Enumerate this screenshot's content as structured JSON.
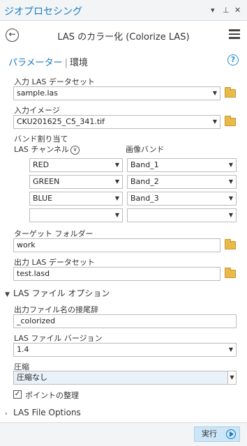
{
  "window": {
    "title": "ジオプロセシング",
    "controls": [
      "▾",
      "⊥",
      "✕"
    ]
  },
  "tool": {
    "title": "LAS のカラー化 (Colorize LAS)"
  },
  "tabs": [
    {
      "label": "パラメーター"
    },
    {
      "label": "環境"
    }
  ],
  "help_label": "?",
  "params": {
    "input_las_label": "入力 LAS データセット",
    "input_las_value": "sample.las",
    "input_image_label": "入力イメージ",
    "input_image_value": "CKU201625_C5_341.tif",
    "band_assign_label": "バンド割り当て",
    "las_channel_label": "LAS チャンネル",
    "image_band_label": "画像バンド",
    "band_rows": [
      {
        "channel": "RED",
        "band": "Band_1"
      },
      {
        "channel": "GREEN",
        "band": "Band_2"
      },
      {
        "channel": "BLUE",
        "band": "Band_3"
      },
      {
        "channel": "",
        "band": ""
      }
    ],
    "target_folder_label": "ターゲット フォルダー",
    "target_folder_value": "work",
    "output_las_label": "出力 LAS データセット",
    "output_las_value": "test.lasd"
  },
  "las_options": {
    "section_label": "LAS ファイル オプション",
    "suffix_label": "出力ファイル名の接尾辞",
    "suffix_value": "_colorized",
    "version_label": "LAS ファイル バージョン",
    "version_value": "1.4",
    "compression_label": "圧縮",
    "compression_value": "圧縮なし",
    "rearrange_label": "ポイントの整理",
    "rearrange_checked": true
  },
  "collapsed_section_label": "LAS File Options",
  "run_label": "実行"
}
